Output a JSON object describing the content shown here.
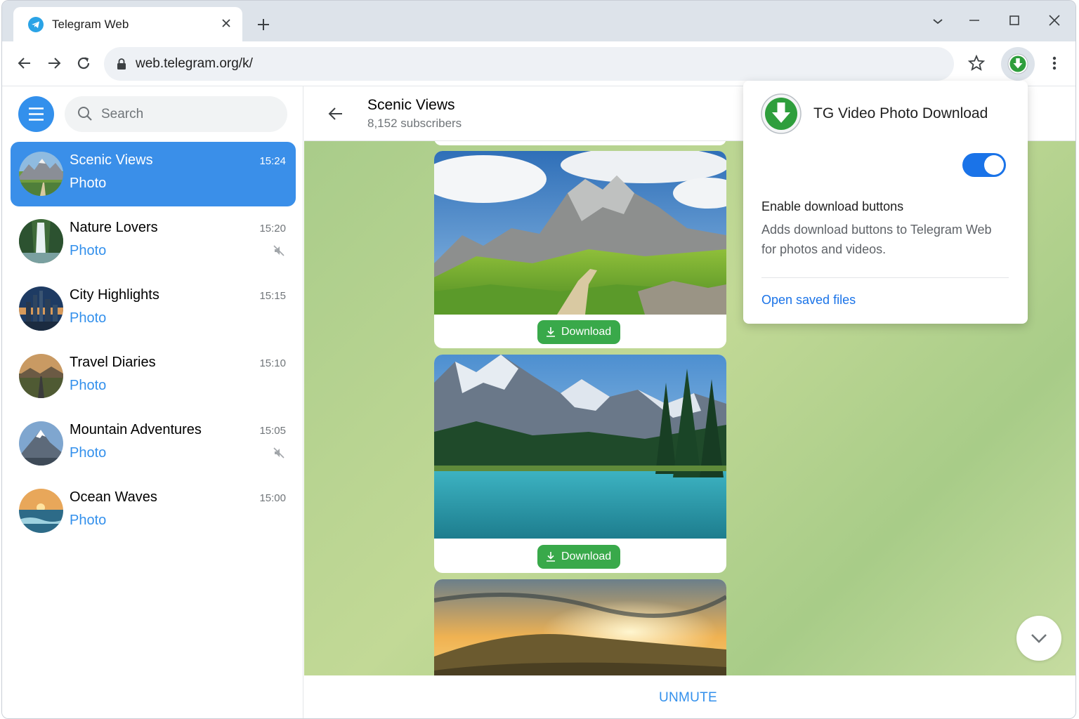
{
  "browser": {
    "tab_title": "Telegram Web",
    "url": "web.telegram.org/k/",
    "icons": [
      "telegram-favicon",
      "close-icon",
      "plus-icon",
      "chevron-down-icon",
      "minimize-icon",
      "maximize-icon",
      "window-close-icon",
      "back-arrow-icon",
      "forward-arrow-icon",
      "reload-icon",
      "lock-icon",
      "star-icon",
      "download-extension-icon",
      "kebab-menu-icon"
    ]
  },
  "sidebar": {
    "search_placeholder": "Search",
    "chats": [
      {
        "name": "Scenic Views",
        "preview": "Photo",
        "time": "15:24",
        "active": true,
        "muted": false
      },
      {
        "name": "Nature Lovers",
        "preview": "Photo",
        "time": "15:20",
        "active": false,
        "muted": true
      },
      {
        "name": "City Highlights",
        "preview": "Photo",
        "time": "15:15",
        "active": false,
        "muted": false
      },
      {
        "name": "Travel Diaries",
        "preview": "Photo",
        "time": "15:10",
        "active": false,
        "muted": false
      },
      {
        "name": "Mountain Adventures",
        "preview": "Photo",
        "time": "15:05",
        "active": false,
        "muted": true
      },
      {
        "name": "Ocean Waves",
        "preview": "Photo",
        "time": "15:00",
        "active": false,
        "muted": false
      }
    ]
  },
  "channel": {
    "title": "Scenic Views",
    "subtitle": "8,152 subscribers",
    "download_label": "Download",
    "unmute_label": "UNMUTE"
  },
  "popup": {
    "title": "TG Video Photo Download",
    "toggle_on": true,
    "option_title": "Enable download buttons",
    "option_desc": "Adds download buttons to Telegram Web for photos and videos.",
    "link": "Open saved files"
  },
  "colors": {
    "accent": "#3390ec",
    "active_chat": "#3a8fe9",
    "download_green": "#39a94a",
    "toggle_blue": "#1a73e8"
  }
}
